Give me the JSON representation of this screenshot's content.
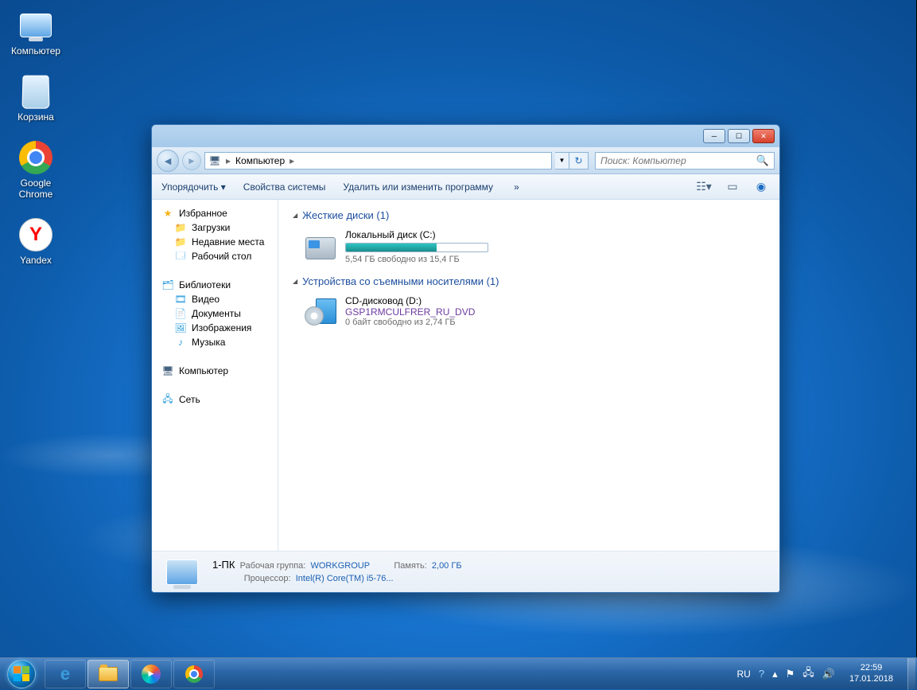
{
  "desktop_icons": {
    "computer": "Компьютер",
    "recycle_bin": "Корзина",
    "chrome": "Google Chrome",
    "yandex": "Yandex"
  },
  "explorer": {
    "breadcrumb": {
      "root": "Компьютер"
    },
    "search_placeholder": "Поиск: Компьютер",
    "commands": {
      "organize": "Упорядочить",
      "sys_props": "Свойства системы",
      "uninstall": "Удалить или изменить программу",
      "overflow": "»"
    },
    "sidebar": {
      "favorites": {
        "head": "Избранное",
        "items": [
          "Загрузки",
          "Недавние места",
          "Рабочий стол"
        ]
      },
      "libraries": {
        "head": "Библиотеки",
        "items": [
          "Видео",
          "Документы",
          "Изображения",
          "Музыка"
        ]
      },
      "computer": "Компьютер",
      "network": "Сеть"
    },
    "groups": {
      "hdd_head": "Жесткие диски (1)",
      "removable_head": "Устройства со съемными носителями (1)"
    },
    "drives": {
      "c": {
        "title": "Локальный диск (C:)",
        "sub": "5,54 ГБ свободно из 15,4 ГБ",
        "fill_pct": 64
      },
      "d": {
        "title": "CD-дисковод (D:)",
        "label": "GSP1RMCULFRER_RU_DVD",
        "sub": "0 байт свободно из 2,74 ГБ"
      }
    },
    "details": {
      "name": "1-ПК",
      "workgroup_lbl": "Рабочая группа:",
      "workgroup_val": "WORKGROUP",
      "cpu_lbl": "Процессор:",
      "cpu_val": "Intel(R) Core(TM) i5-76...",
      "mem_lbl": "Память:",
      "mem_val": "2,00 ГБ"
    }
  },
  "tray": {
    "lang": "RU",
    "time": "22:59",
    "date": "17.01.2018"
  }
}
